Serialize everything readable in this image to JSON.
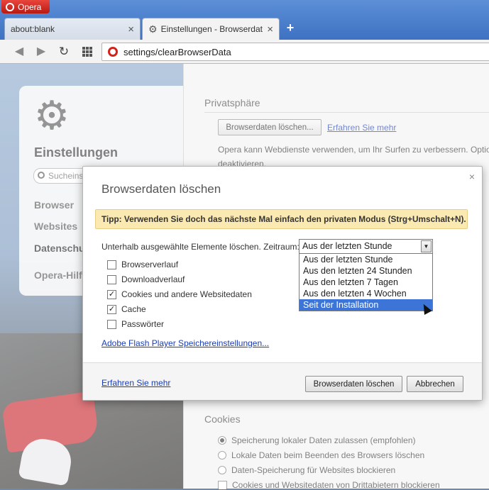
{
  "browser": {
    "menu_label": "Opera",
    "tabs": [
      {
        "title": "about:blank",
        "close": "×"
      },
      {
        "title": "Einstellungen - Browserdaten löschen",
        "close": "×"
      }
    ],
    "new_tab": "+",
    "address": "settings/clearBrowserData"
  },
  "sidebar": {
    "title": "Einstellungen",
    "search_placeholder": "Sucheinstellungen",
    "items": [
      "Browser",
      "Websites",
      "Datenschutz & Sicherheit",
      "Opera-Hilfe"
    ]
  },
  "page": {
    "privacy_title": "Privatsphäre",
    "clear_button": "Browserdaten löschen...",
    "learn_more": "Erfahren Sie mehr",
    "privacy_text_1": "Opera kann Webdienste verwenden, um Ihr Surfen zu verbessern. Optional",
    "privacy_text_2": "deaktivieren.",
    "cookies_title": "Cookies",
    "cookie_options": [
      "Speicherung lokaler Daten zulassen (empfohlen)",
      "Lokale Daten beim Beenden des Browsers löschen",
      "Daten-Speicherung für Websites blockieren",
      "Cookies und Websitedaten von Drittabietern blockieren"
    ]
  },
  "dialog": {
    "title": "Browserdaten löschen",
    "close": "×",
    "tip": "Tipp: Verwenden Sie doch das nächste Mal einfach den privaten Modus (Strg+Umschalt+N).",
    "range_label": "Unterhalb ausgewählte Elemente löschen. Zeitraum:",
    "range_selected": "Aus der letzten Stunde",
    "range_options": [
      "Aus der letzten Stunde",
      "Aus den letzten 24 Stunden",
      "Aus den letzten 7 Tagen",
      "Aus den letzten 4 Wochen",
      "Seit der Installation"
    ],
    "highlighted_option_index": 4,
    "checkboxes": [
      {
        "label": "Browserverlauf",
        "checked": false
      },
      {
        "label": "Downloadverlauf",
        "checked": false
      },
      {
        "label": "Cookies und andere Websitedaten",
        "checked": true
      },
      {
        "label": "Cache",
        "checked": true
      },
      {
        "label": "Passwörter",
        "checked": false
      }
    ],
    "flash_link": "Adobe Flash Player Speichereinstellungen...",
    "footer_link": "Erfahren Sie mehr",
    "confirm_button": "Browserdaten löschen",
    "cancel_button": "Abbrechen"
  },
  "icons": {
    "back": "arrow-left-icon",
    "forward": "arrow-right-icon",
    "reload": "reload-icon",
    "speed_dial": "grid-icon",
    "settings": "gear-icon"
  },
  "colors": {
    "accent_highlight": "#3c74d8",
    "tip_background": "#fbe9b2",
    "link": "#1a3db4",
    "opera_red": "#d4231a"
  }
}
